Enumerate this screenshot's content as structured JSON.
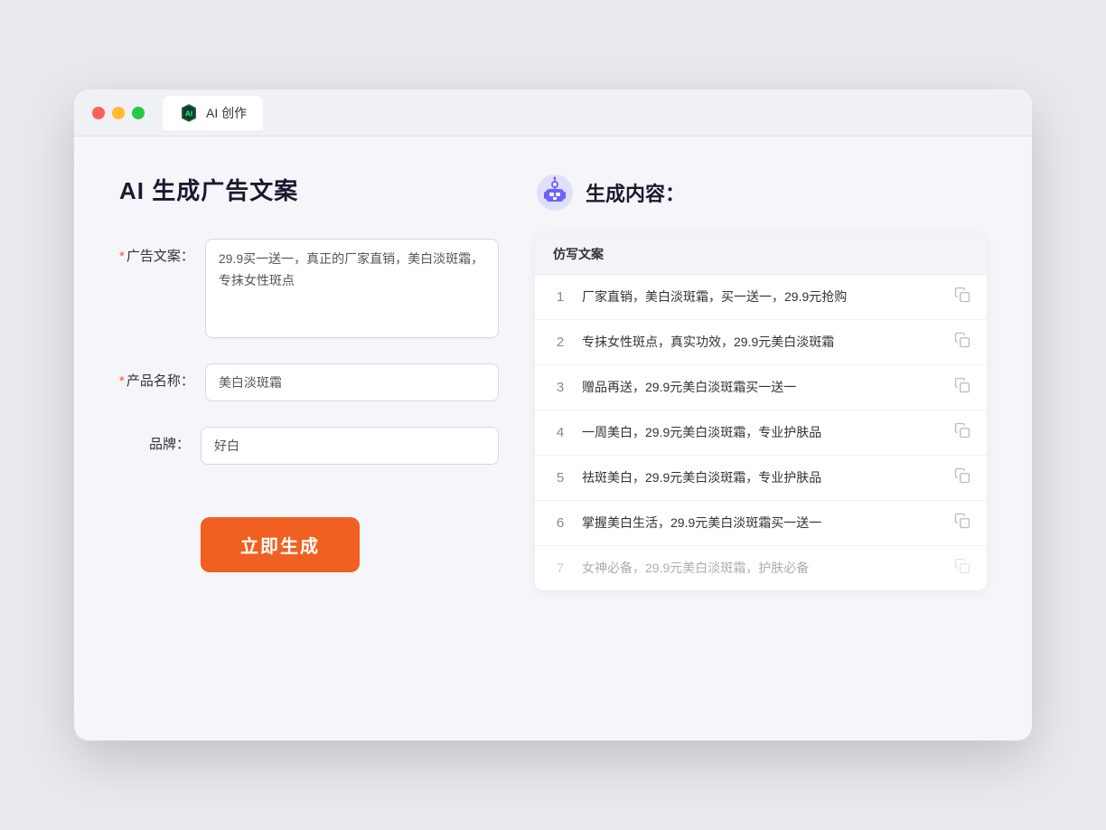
{
  "browser": {
    "tab_title": "AI 创作"
  },
  "left_panel": {
    "page_title": "AI 生成广告文案",
    "form": {
      "ad_copy_label": "广告文案：",
      "ad_copy_required": "*",
      "ad_copy_value": "29.9买一送一，真正的厂家直销，美白淡斑霜，专抹女性斑点",
      "product_label": "产品名称：",
      "product_required": "*",
      "product_value": "美白淡斑霜",
      "brand_label": "品牌：",
      "brand_value": "好白"
    },
    "generate_button": "立即生成"
  },
  "right_panel": {
    "title": "生成内容：",
    "table_header": "仿写文案",
    "rows": [
      {
        "number": "1",
        "text": "厂家直销，美白淡斑霜，买一送一，29.9元抢购",
        "faded": false
      },
      {
        "number": "2",
        "text": "专抹女性斑点，真实功效，29.9元美白淡斑霜",
        "faded": false
      },
      {
        "number": "3",
        "text": "赠品再送，29.9元美白淡斑霜买一送一",
        "faded": false
      },
      {
        "number": "4",
        "text": "一周美白，29.9元美白淡斑霜，专业护肤品",
        "faded": false
      },
      {
        "number": "5",
        "text": "祛斑美白，29.9元美白淡斑霜，专业护肤品",
        "faded": false
      },
      {
        "number": "6",
        "text": "掌握美白生活，29.9元美白淡斑霜买一送一",
        "faded": false
      },
      {
        "number": "7",
        "text": "女神必备，29.9元美白淡斑霜，护肤必备",
        "faded": true
      }
    ]
  }
}
